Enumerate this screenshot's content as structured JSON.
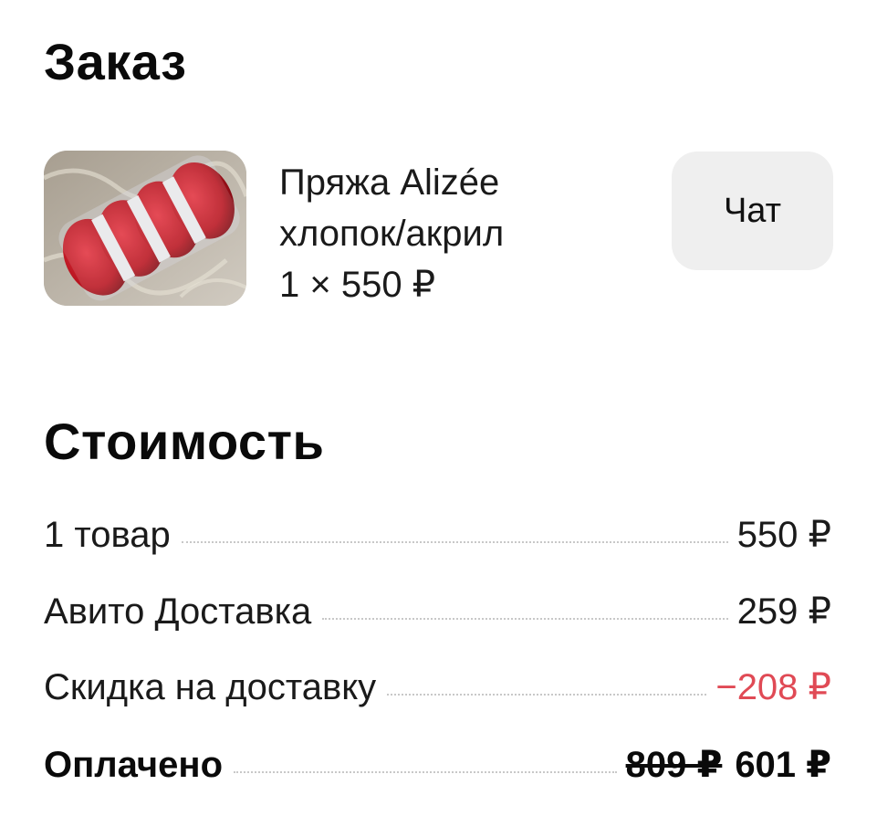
{
  "order": {
    "title": "Заказ",
    "product": {
      "name_line1": "Пряжа Alizée",
      "name_line2": "хлопок/акрил",
      "quantity_price": "1 × 550 ₽",
      "image": "yarn-photo"
    },
    "chat_label": "Чат"
  },
  "cost": {
    "title": "Стоимость",
    "items": [
      {
        "label": "1 товар",
        "value": "550 ₽"
      },
      {
        "label": "Авито Доставка",
        "value": "259 ₽"
      },
      {
        "label": "Скидка на доставку",
        "value": "−208 ₽"
      }
    ],
    "paid": {
      "label": "Оплачено",
      "old_value": "809 ₽",
      "value": "601 ₽"
    }
  },
  "colors": {
    "discount": "#e04a55",
    "chat_button_bg": "#efefef",
    "text": "#111111"
  }
}
